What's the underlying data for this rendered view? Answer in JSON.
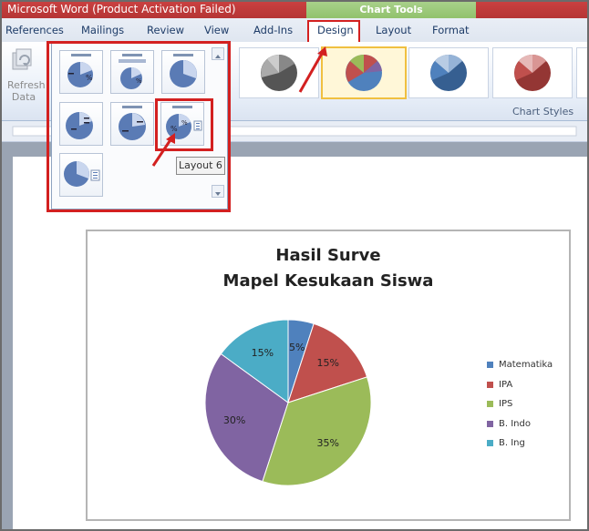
{
  "window": {
    "title": "Microsoft Word (Product Activation Failed)"
  },
  "contextual_group": {
    "label": "Chart Tools",
    "color": "#8cbf66"
  },
  "tabs": [
    {
      "label": "References"
    },
    {
      "label": "Mailings"
    },
    {
      "label": "Review"
    },
    {
      "label": "View"
    },
    {
      "label": "Add-Ins"
    },
    {
      "label": "Design",
      "selected": true
    },
    {
      "label": "Layout"
    },
    {
      "label": "Format"
    }
  ],
  "ribbon": {
    "refresh": {
      "line1": "Refresh",
      "line2": "Data",
      "icon": "refresh-data-icon"
    },
    "chart_styles_label": "Chart Styles"
  },
  "layouts": {
    "tooltip": "Layout 6",
    "items": [
      "Layout 1",
      "Layout 2",
      "Layout 3",
      "Layout 4",
      "Layout 5",
      "Layout 6",
      "Layout 7"
    ],
    "highlight_color": "#d32020"
  },
  "chart": {
    "title_line1": "Hasil Surve",
    "title_line2": "Mapel Kesukaan Siswa"
  },
  "chart_data": {
    "type": "pie",
    "title": "Hasil Surve Mapel Kesukaan Siswa",
    "categories": [
      "Matematika",
      "IPA",
      "IPS",
      "B. Indo",
      "B. Ing"
    ],
    "values": [
      5,
      15,
      35,
      30,
      15
    ],
    "labels": [
      "5%",
      "15%",
      "35%",
      "30%",
      "15%"
    ],
    "colors": [
      "#4f81bd",
      "#c0504d",
      "#9bbb59",
      "#8064a2",
      "#4bacc6"
    ],
    "legend": "right"
  }
}
